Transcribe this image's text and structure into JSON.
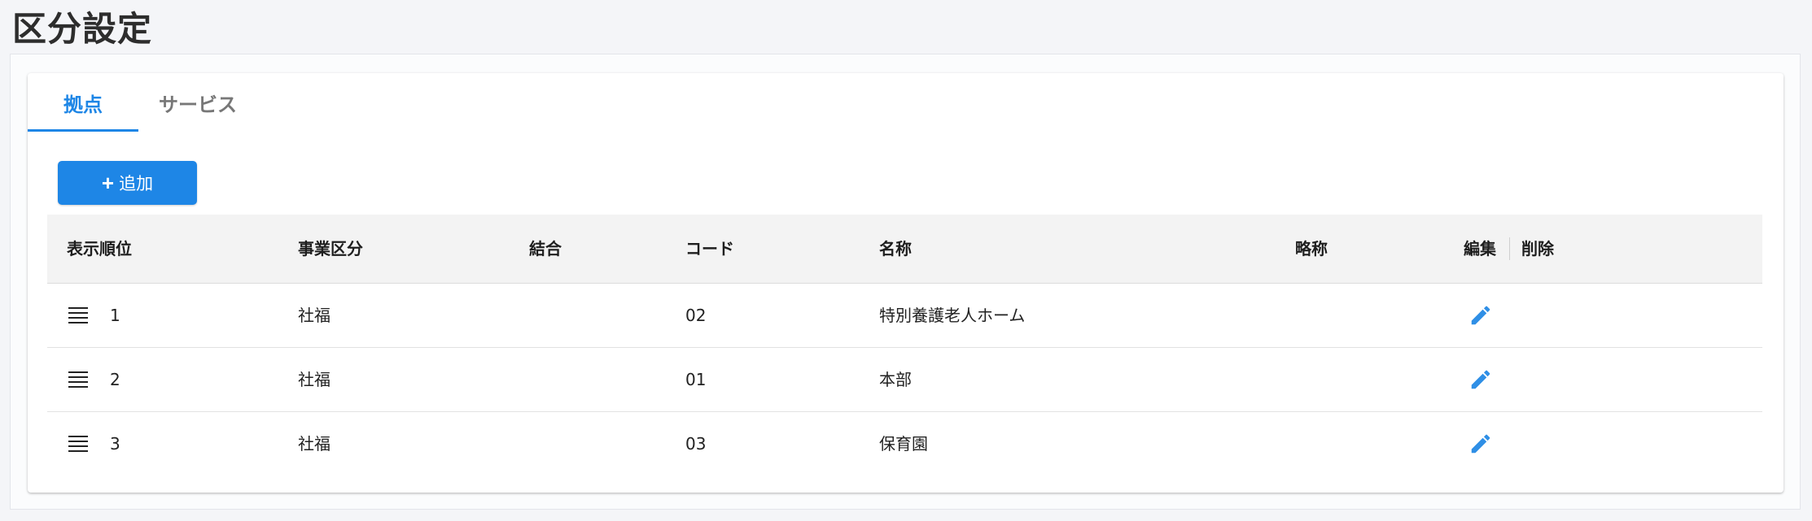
{
  "page": {
    "title": "区分設定"
  },
  "tabs": [
    {
      "label": "拠点",
      "active": true
    },
    {
      "label": "サービス",
      "active": false
    }
  ],
  "toolbar": {
    "add_label": "追加",
    "add_icon": "plus-icon"
  },
  "table": {
    "columns": {
      "order": "表示順位",
      "business_category": "事業区分",
      "merge": "結合",
      "code": "コード",
      "name": "名称",
      "abbreviation": "略称",
      "edit": "編集",
      "delete": "削除"
    },
    "rows": [
      {
        "order": "1",
        "business_category": "社福",
        "merge": "",
        "code": "02",
        "name": "特別養護老人ホーム",
        "abbreviation": ""
      },
      {
        "order": "2",
        "business_category": "社福",
        "merge": "",
        "code": "01",
        "name": "本部",
        "abbreviation": ""
      },
      {
        "order": "3",
        "business_category": "社福",
        "merge": "",
        "code": "03",
        "name": "保育園",
        "abbreviation": ""
      }
    ]
  },
  "colors": {
    "accent": "#1e86e6",
    "edit_icon": "#2f8fe6",
    "header_bg": "#f3f3f3",
    "page_bg": "#f4f5f8"
  }
}
